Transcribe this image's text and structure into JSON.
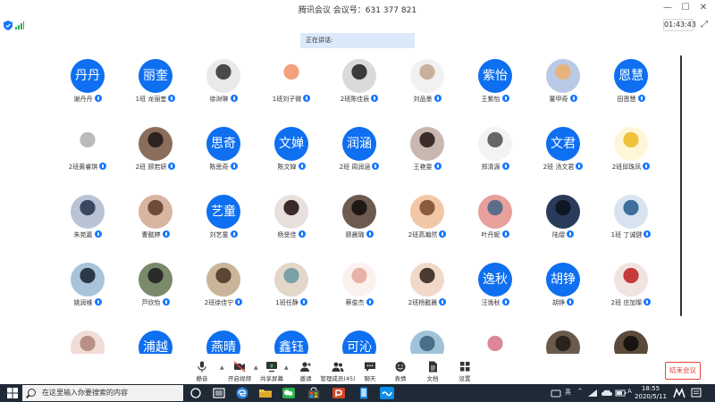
{
  "window": {
    "title": "腾讯会议 会议号：631 377 821",
    "minimize_glyph": "—",
    "maximize_glyph": "☐",
    "close_glyph": "✕",
    "fullscreen_glyph": "⤢"
  },
  "status": {
    "timer": "01:43:43",
    "speaking_label": "正在讲话:",
    "signal_color": "#2bb24c",
    "shield_color": "#1677ff"
  },
  "colors": {
    "avatar_blue": "#0e6ff0",
    "mic_blue": "#1677ff",
    "end_red": "#e6443a",
    "taskbar": "#1f2a36"
  },
  "participants": [
    {
      "name": "谢丹丹",
      "avatar_text": "丹丹",
      "avatar_type": "text"
    },
    {
      "name": "1班 龙丽奎",
      "avatar_text": "丽奎",
      "avatar_type": "text"
    },
    {
      "name": "徐澍琳",
      "avatar_type": "photo",
      "c1": "#e9e9e9",
      "c2": "#4a4a4a"
    },
    {
      "name": "1班刘子微",
      "avatar_type": "photo",
      "c1": "#ffffff",
      "c2": "#f4a07a"
    },
    {
      "name": "2班陈佳辰",
      "avatar_type": "photo",
      "c1": "#dadada",
      "c2": "#3b3b3b"
    },
    {
      "name": "刘品墨",
      "avatar_type": "photo",
      "c1": "#f1f1f1",
      "c2": "#c8b09a"
    },
    {
      "name": "王紫怡",
      "avatar_text": "紫怡",
      "avatar_type": "text"
    },
    {
      "name": "董甲奇",
      "avatar_type": "photo",
      "c1": "#b9c9e6",
      "c2": "#e6b47a"
    },
    {
      "name": "田恩慧",
      "avatar_text": "恩慧",
      "avatar_type": "text"
    },
    {
      "name": "2班黄睿琪",
      "avatar_type": "photo",
      "c1": "#ffffff",
      "c2": "#bbbbbb"
    },
    {
      "name": "2班 顾若妍",
      "avatar_type": "photo",
      "c1": "#8a6d5b",
      "c2": "#2e2320"
    },
    {
      "name": "陈思奇",
      "avatar_text": "思奇",
      "avatar_type": "text"
    },
    {
      "name": "陈文婵",
      "avatar_text": "文婵",
      "avatar_type": "text"
    },
    {
      "name": "2班 周润涵",
      "avatar_text": "润涵",
      "avatar_type": "text"
    },
    {
      "name": "王艳雯",
      "avatar_type": "photo",
      "c1": "#c9b7b0",
      "c2": "#3b2d2a"
    },
    {
      "name": "郑清源",
      "avatar_type": "photo",
      "c1": "#f3f3f3",
      "c2": "#666666"
    },
    {
      "name": "2班 汤文君",
      "avatar_text": "文君",
      "avatar_type": "text"
    },
    {
      "name": "2班邱珠凤",
      "avatar_type": "photo",
      "c1": "#fff6d8",
      "c2": "#f0c23a"
    },
    {
      "name": "朱苑嘉",
      "avatar_type": "photo",
      "c1": "#b8c4d6",
      "c2": "#374860"
    },
    {
      "name": "曹懿婷",
      "avatar_type": "photo",
      "c1": "#d9b4a0",
      "c2": "#6e4a3a"
    },
    {
      "name": "刘艺童",
      "avatar_text": "艺童",
      "avatar_type": "text"
    },
    {
      "name": "杨旻佳",
      "avatar_type": "photo",
      "c1": "#e8e0dc",
      "c2": "#3a2a2a"
    },
    {
      "name": "顾晨璐",
      "avatar_type": "photo",
      "c1": "#6d5a50",
      "c2": "#1f1815"
    },
    {
      "name": "2班高瀚然",
      "avatar_type": "photo",
      "c1": "#f2c7a6",
      "c2": "#8a5c3e"
    },
    {
      "name": "叶丹妮",
      "avatar_type": "photo",
      "c1": "#e7a09b",
      "c2": "#5a6d8a"
    },
    {
      "name": "陆熠",
      "avatar_type": "photo",
      "c1": "#2a3a5a",
      "c2": "#0f1626"
    },
    {
      "name": "1班 丁诚健",
      "avatar_type": "photo",
      "c1": "#d7e4f0",
      "c2": "#3f6e9a"
    },
    {
      "name": "姚润维",
      "avatar_type": "photo",
      "c1": "#a9c3d8",
      "c2": "#2a3a48"
    },
    {
      "name": "芦欣怡",
      "avatar_type": "photo",
      "c1": "#7a8a6a",
      "c2": "#2b2b2b"
    },
    {
      "name": "2班徐佳宁",
      "avatar_type": "photo",
      "c1": "#cbb59a",
      "c2": "#5a4636"
    },
    {
      "name": "1班任静",
      "avatar_type": "photo",
      "c1": "#e3d7c9",
      "c2": "#7aa0a8"
    },
    {
      "name": "蔡俊杰",
      "avatar_type": "photo",
      "c1": "#fbf1ee",
      "c2": "#e6b2a8"
    },
    {
      "name": "2班杨懿晨",
      "avatar_type": "photo",
      "c1": "#f1d8c8",
      "c2": "#4a3a32"
    },
    {
      "name": "汪逸秋",
      "avatar_text": "逸秋",
      "avatar_type": "text"
    },
    {
      "name": "胡铮",
      "avatar_text": "胡铮",
      "avatar_type": "text"
    },
    {
      "name": "2班 庄加璨",
      "avatar_type": "photo",
      "c1": "#f1e3e0",
      "c2": "#c73a3a"
    },
    {
      "name": "",
      "avatar_type": "photo",
      "c1": "#f2dcd6",
      "c2": "#b89088"
    },
    {
      "name": "",
      "avatar_text": "浦越",
      "avatar_type": "text"
    },
    {
      "name": "",
      "avatar_text": "燕晴",
      "avatar_type": "text"
    },
    {
      "name": "",
      "avatar_text": "鑫钰",
      "avatar_type": "text"
    },
    {
      "name": "",
      "avatar_text": "可沁",
      "avatar_type": "text"
    },
    {
      "name": "",
      "avatar_type": "photo",
      "c1": "#9fc3d9",
      "c2": "#4a6f88"
    },
    {
      "name": "",
      "avatar_type": "photo",
      "c1": "#ffffff",
      "c2": "#dd8899"
    },
    {
      "name": "",
      "avatar_type": "photo",
      "c1": "#6a5a4c",
      "c2": "#2a221c"
    },
    {
      "name": "",
      "avatar_type": "photo",
      "c1": "#5a4a3a",
      "c2": "#1a1410"
    }
  ],
  "toolbar": {
    "mute": "静音",
    "video": "开启视频",
    "share": "共享屏幕",
    "invite": "邀请",
    "members": "管理成员(45)",
    "chat": "聊天",
    "reactions": "表情",
    "docs": "文档",
    "settings": "设置",
    "end_meeting": "结束会议",
    "caret": "▲"
  },
  "taskbar": {
    "search_placeholder": "在这里输入你要搜索的内容",
    "time": "18:55",
    "date": "2020/5/11",
    "ime": "英",
    "tray_a": "^",
    "tray_b": "A"
  }
}
